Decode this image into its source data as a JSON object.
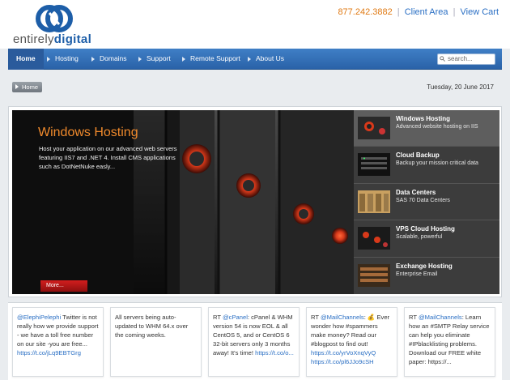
{
  "brand": {
    "word1": "entirely",
    "word2": "digital"
  },
  "top_links": {
    "phone": "877.242.3882",
    "sep": "|",
    "client_area": "Client Area",
    "view_cart": "View Cart"
  },
  "nav": {
    "items": [
      {
        "label": "Home"
      },
      {
        "label": "Hosting"
      },
      {
        "label": "Domains"
      },
      {
        "label": "Support"
      },
      {
        "label": "Remote Support"
      },
      {
        "label": "About Us"
      }
    ],
    "search_placeholder": "search..."
  },
  "breadcrumb": {
    "home": "Home"
  },
  "date": "Tuesday, 20 June 2017",
  "slide": {
    "title": "Windows Hosting",
    "description": "Host your application on our advanced web servers featuring IIS7 and .NET 4. Install CMS applications such as DotNetNuke easly...",
    "more_label": "More..."
  },
  "thumbs": [
    {
      "title": "Windows Hosting",
      "subtitle": "Advanced website hosting on IIS"
    },
    {
      "title": "Cloud Backup",
      "subtitle": "Backup your mission critical data"
    },
    {
      "title": "Data Centers",
      "subtitle": "SAS 70 Data Centers"
    },
    {
      "title": "VPS Cloud Hosting",
      "subtitle": "Scalable, powerful"
    },
    {
      "title": "Exchange Hosting",
      "subtitle": "Enterprise Email"
    }
  ],
  "tweets": [
    {
      "mention": "@ElephiPelephi",
      "text": " Twitter is not really how we provide support - we have a toll free number on our site -you are free...",
      "link": "https://t.co/jLq9EBTGrg"
    },
    {
      "mention": "",
      "text": "All servers being auto-updated to WHM 64.x over the coming weeks.",
      "link": ""
    },
    {
      "mention": "@cPanel",
      "prefix": "RT ",
      "text": ": cPanel & WHM version 54 is now EOL & all CentOS 5, and or CentOS 6 32-bit servers only 3 months away! It's time!",
      "link": "https://t.co/o..."
    },
    {
      "mention": "@MailChannels",
      "prefix": "RT ",
      "text": ": 💰 Ever wonder how #spammers make money? Read our #blogpost to find out!",
      "link": "https://t.co/yrVoXnqVyQ https://t.co/pl6JJo9cSH"
    },
    {
      "mention": "@MailChannels",
      "prefix": "RT ",
      "text": ": Learn how an #SMTP Relay service can help you eliminate #IPblacklisting problems. Download our FREE white paper: https://...",
      "link": ""
    }
  ],
  "colors": {
    "nav": "#2f6db5",
    "accent_orange": "#f08a2c",
    "link_blue": "#2a6fc4",
    "more_red": "#c61a1a"
  }
}
